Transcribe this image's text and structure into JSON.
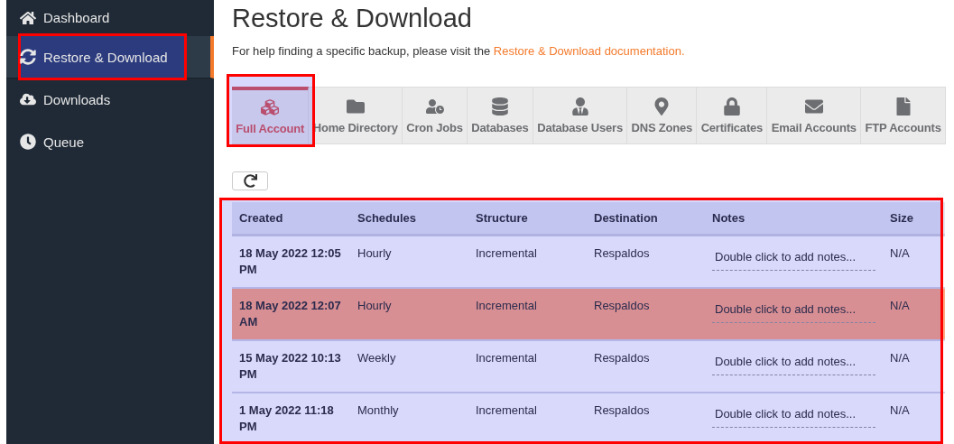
{
  "sidebar": {
    "items": [
      {
        "label": "Dashboard",
        "selected": false,
        "highlighted": false
      },
      {
        "label": "Restore & Download",
        "selected": true,
        "highlighted": true
      },
      {
        "label": "Downloads",
        "selected": false,
        "highlighted": false
      },
      {
        "label": "Queue",
        "selected": false,
        "highlighted": false
      }
    ]
  },
  "page": {
    "title": "Restore & Download",
    "help": "For help finding a specific backup, please visit the",
    "help_link": "Restore & Download documentation."
  },
  "tabs": [
    {
      "label": "Full Account",
      "selected": true,
      "highlighted": true
    },
    {
      "label": "Home Directory",
      "selected": false,
      "highlighted": false
    },
    {
      "label": "Cron Jobs",
      "selected": false,
      "highlighted": false
    },
    {
      "label": "Databases",
      "selected": false,
      "highlighted": false
    },
    {
      "label": "Database Users",
      "selected": false,
      "highlighted": false
    },
    {
      "label": "DNS Zones",
      "selected": false,
      "highlighted": false
    },
    {
      "label": "Certificates",
      "selected": false,
      "highlighted": false
    },
    {
      "label": "Email Accounts",
      "selected": false,
      "highlighted": false
    },
    {
      "label": "FTP Accounts",
      "selected": false,
      "highlighted": false
    }
  ],
  "table": {
    "highlighted": true,
    "columns": [
      "Created",
      "Schedules",
      "Structure",
      "Destination",
      "Notes",
      "Size"
    ],
    "rows": [
      {
        "created": "18 May 2022 12:05 PM",
        "schedule": "Hourly",
        "structure": "Incremental",
        "destination": "Respaldos",
        "notes_placeholder": "Double click to add notes...",
        "size": "N/A",
        "selected": false
      },
      {
        "created": "18 May 2022 12:07 AM",
        "schedule": "Hourly",
        "structure": "Incremental",
        "destination": "Respaldos",
        "notes_placeholder": "Double click to add notes...",
        "size": "N/A",
        "selected": true
      },
      {
        "created": "15 May 2022 10:13 PM",
        "schedule": "Weekly",
        "structure": "Incremental",
        "destination": "Respaldos",
        "notes_placeholder": "Double click to add notes...",
        "size": "N/A",
        "selected": false
      },
      {
        "created": "1 May 2022 11:18 PM",
        "schedule": "Monthly",
        "structure": "Incremental",
        "destination": "Respaldos",
        "notes_placeholder": "Double click to add notes...",
        "size": "N/A",
        "selected": false
      }
    ]
  }
}
